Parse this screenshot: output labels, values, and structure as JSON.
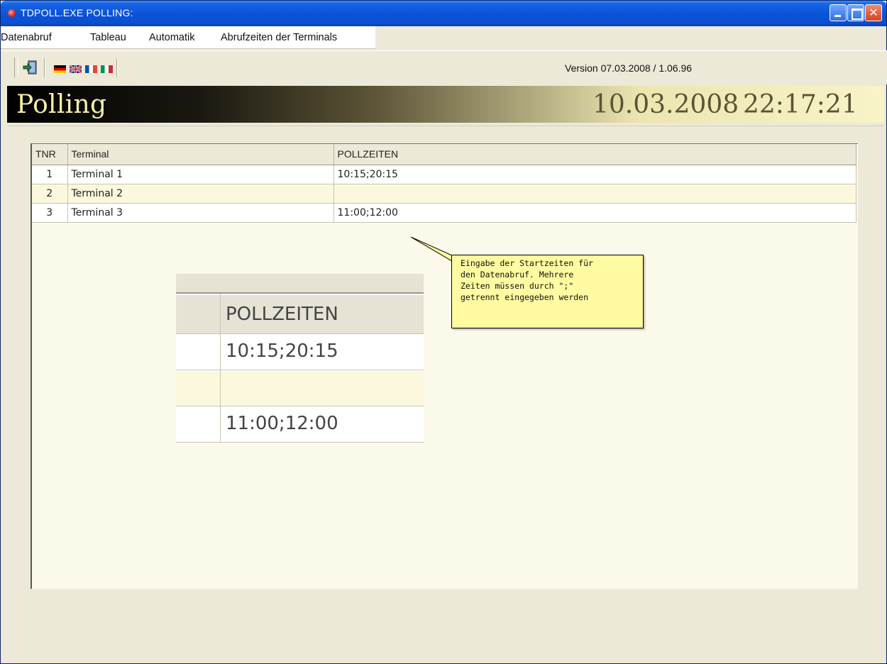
{
  "window": {
    "title": "TDPOLL.EXE POLLING:"
  },
  "menu": {
    "items": [
      {
        "label": "Datenabruf"
      },
      {
        "label": "Tableau"
      },
      {
        "label": "Automatik"
      },
      {
        "label": "Abrufzeiten der Terminals"
      }
    ]
  },
  "toolbar": {
    "version": "Version 07.03.2008 / 1.06.96",
    "icons": [
      "exit-icon",
      "flag-de-icon",
      "flag-gb-icon",
      "flag-fr-icon",
      "flag-it-icon"
    ]
  },
  "header": {
    "title": "Polling",
    "date": "10.03.2008",
    "time": "22:17:21"
  },
  "table": {
    "columns": [
      "TNR",
      "Terminal",
      "POLLZEITEN"
    ],
    "rows": [
      {
        "tnr": "1",
        "terminal": "Terminal 1",
        "pollzeiten": "10:15;20:15"
      },
      {
        "tnr": "2",
        "terminal": "Terminal 2",
        "pollzeiten": ""
      },
      {
        "tnr": "3",
        "terminal": "Terminal 3",
        "pollzeiten": "11:00;12:00"
      }
    ]
  },
  "tooltip": {
    "lines": [
      "Eingabe der Startzeiten für",
      "den Datenabruf. Mehrere",
      "Zeiten müssen durch \";\"",
      "getrennt eingegeben werden"
    ]
  },
  "zoom": {
    "header": "POLLZEITEN",
    "values": [
      "10:15;20:15",
      "",
      "11:00;12:00"
    ]
  },
  "colors": {
    "titlebar": "#0a54d8",
    "banner_text": "#f6f1a5",
    "tooltip_bg": "#fffba0",
    "alt_row": "#fbf8dd"
  }
}
